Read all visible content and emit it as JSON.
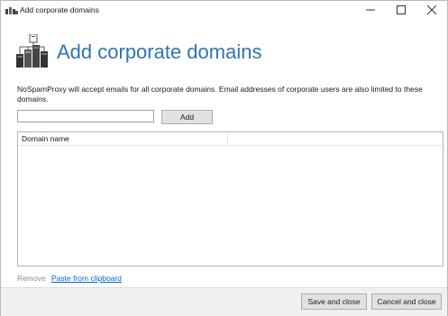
{
  "window": {
    "title": "Add corporate domains",
    "controls": {
      "minimize": "minimize",
      "maximize": "maximize",
      "close": "close"
    }
  },
  "header": {
    "title": "Add corporate domains",
    "icon": "servers-icon"
  },
  "description": "NoSpamProxy will accept emails for all corporate domains. Email addresses of corporate users are also limited to these domains.",
  "domain_input": {
    "value": "",
    "placeholder": ""
  },
  "add_button": {
    "label": "Add"
  },
  "domain_list": {
    "columns": [
      "Domain name"
    ],
    "rows": []
  },
  "links": {
    "remove": "Remove",
    "paste": "Paste from clipboard"
  },
  "footer": {
    "save_label": "Save and close",
    "cancel_label": "Cancel and close"
  },
  "colors": {
    "accent": "#2e74b5",
    "link": "#0066cc",
    "footer_bg": "#f0f0f0"
  }
}
